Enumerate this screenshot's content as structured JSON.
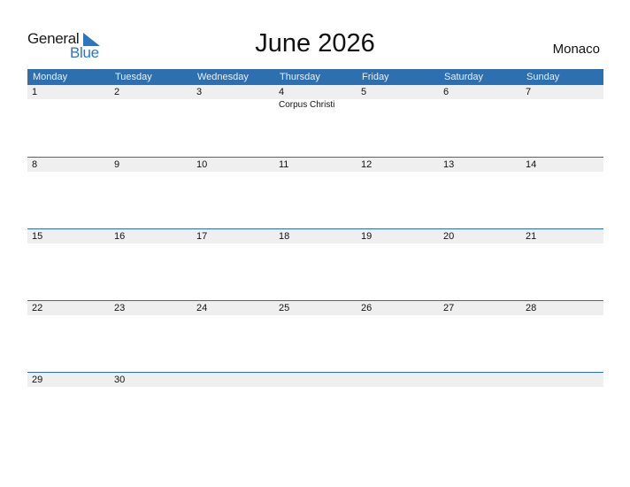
{
  "logo": {
    "line1": "General",
    "line2": "Blue",
    "icon": "triangle-flag-icon",
    "color": "#2a77c0"
  },
  "title": "June 2026",
  "country": "Monaco",
  "colors": {
    "header_bg": "#2e6fb0",
    "date_strip": "#efefef",
    "row_border": "#2e6fb0"
  },
  "weekdays": [
    "Monday",
    "Tuesday",
    "Wednesday",
    "Thursday",
    "Friday",
    "Saturday",
    "Sunday"
  ],
  "weeks": [
    {
      "days": [
        {
          "num": "1",
          "event": ""
        },
        {
          "num": "2",
          "event": ""
        },
        {
          "num": "3",
          "event": ""
        },
        {
          "num": "4",
          "event": "Corpus Christi"
        },
        {
          "num": "5",
          "event": ""
        },
        {
          "num": "6",
          "event": ""
        },
        {
          "num": "7",
          "event": ""
        }
      ]
    },
    {
      "days": [
        {
          "num": "8",
          "event": ""
        },
        {
          "num": "9",
          "event": ""
        },
        {
          "num": "10",
          "event": ""
        },
        {
          "num": "11",
          "event": ""
        },
        {
          "num": "12",
          "event": ""
        },
        {
          "num": "13",
          "event": ""
        },
        {
          "num": "14",
          "event": ""
        }
      ]
    },
    {
      "days": [
        {
          "num": "15",
          "event": ""
        },
        {
          "num": "16",
          "event": ""
        },
        {
          "num": "17",
          "event": ""
        },
        {
          "num": "18",
          "event": ""
        },
        {
          "num": "19",
          "event": ""
        },
        {
          "num": "20",
          "event": ""
        },
        {
          "num": "21",
          "event": ""
        }
      ]
    },
    {
      "days": [
        {
          "num": "22",
          "event": ""
        },
        {
          "num": "23",
          "event": ""
        },
        {
          "num": "24",
          "event": ""
        },
        {
          "num": "25",
          "event": ""
        },
        {
          "num": "26",
          "event": ""
        },
        {
          "num": "27",
          "event": ""
        },
        {
          "num": "28",
          "event": ""
        }
      ]
    },
    {
      "days": [
        {
          "num": "29",
          "event": ""
        },
        {
          "num": "30",
          "event": ""
        },
        {
          "num": "",
          "event": ""
        },
        {
          "num": "",
          "event": ""
        },
        {
          "num": "",
          "event": ""
        },
        {
          "num": "",
          "event": ""
        },
        {
          "num": "",
          "event": ""
        }
      ]
    }
  ]
}
